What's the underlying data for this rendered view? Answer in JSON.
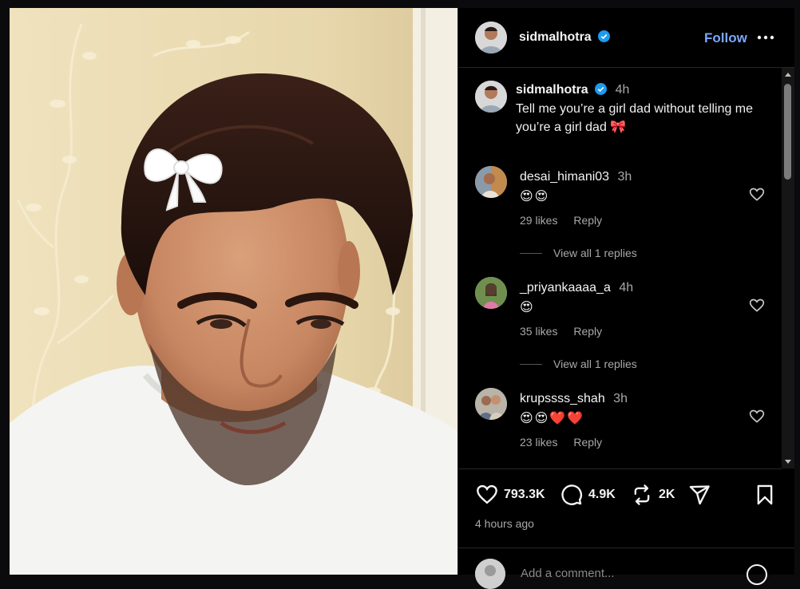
{
  "header": {
    "username": "sidmalhotra",
    "follow_label": "Follow",
    "more_icon": "more-horizontal-icon"
  },
  "caption": {
    "username": "sidmalhotra",
    "time": "4h",
    "text": "Tell me you’re a girl dad without telling me you’re a girl dad 🎀"
  },
  "comments": [
    {
      "username": "desai_himani03",
      "time": "3h",
      "text": "😍😍",
      "likes": "29 likes",
      "reply_label": "Reply",
      "view_replies": "View all 1 replies"
    },
    {
      "username": "_priyankaaaa_a",
      "time": "4h",
      "text": "😍",
      "likes": "35 likes",
      "reply_label": "Reply",
      "view_replies": "View all 1 replies"
    },
    {
      "username": "krupssss_shah",
      "time": "3h",
      "text": "😍😍❤️❤️",
      "likes": "23 likes",
      "reply_label": "Reply"
    }
  ],
  "actions": {
    "likes": "793.3K",
    "comments": "4.9K",
    "reposts": "2K"
  },
  "posted_time": "4 hours ago",
  "add_comment": {
    "placeholder": "Add a comment..."
  },
  "colors": {
    "background": "#000000",
    "link_blue": "#7aa6ff",
    "verified": "#1d9bf0",
    "secondary_text": "#a8a8a8"
  }
}
